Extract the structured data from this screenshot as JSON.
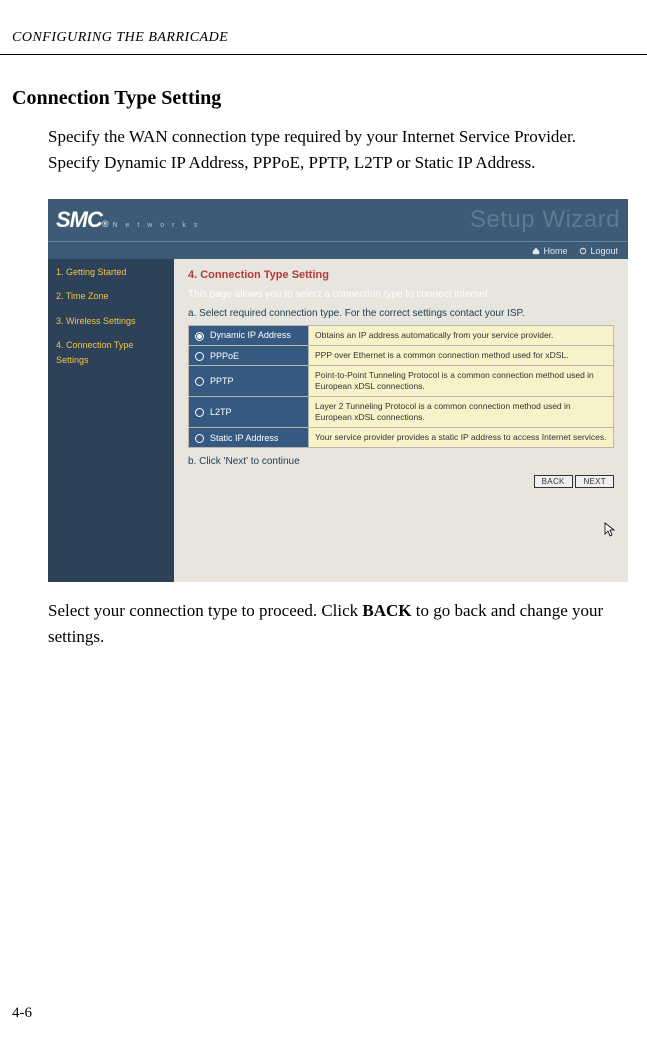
{
  "running_header": "CONFIGURING THE BARRICADE",
  "section_title": "Connection Type Setting",
  "intro": "Specify the WAN connection type required by your Internet Service Provider. Specify Dynamic IP Address, PPPoE, PPTP, L2TP or Static IP Address.",
  "outro_pre": "Select your connection type to proceed. Click ",
  "outro_bold": "BACK",
  "outro_post": " to go back and change your settings.",
  "page_number": "4-6",
  "shot": {
    "logo": "SMC",
    "logo_reg": "®",
    "logo_sub": "N e t w o r k s",
    "wizard": "Setup Wizard",
    "toolbar": {
      "home": "Home",
      "logout": "Logout"
    },
    "sidebar": {
      "items": [
        {
          "label": "1. Getting Started"
        },
        {
          "label": "2. Time Zone"
        },
        {
          "label": "3. Wireless Settings"
        },
        {
          "label": "4. Connection Type Settings"
        }
      ]
    },
    "panel": {
      "title": "4. Connection Type Setting",
      "line1": "This page allows you to select a connection type to connect internet.",
      "line2": "a. Select required connection type. For the correct settings contact your ISP.",
      "options": [
        {
          "name": "Dynamic IP Address",
          "desc": "Obtains an IP address automatically from your service provider.",
          "selected": true
        },
        {
          "name": "PPPoE",
          "desc": "PPP over Ethernet is a common connection method used for xDSL.",
          "selected": false
        },
        {
          "name": "PPTP",
          "desc": "Point-to-Point Tunneling Protocol is a common connection method used in European xDSL connections.",
          "selected": false
        },
        {
          "name": "L2TP",
          "desc": "Layer 2 Tunneling Protocol is a common connection method used in European xDSL connections.",
          "selected": false
        },
        {
          "name": "Static IP Address",
          "desc": "Your service provider provides a static IP address to access Internet services.",
          "selected": false
        }
      ],
      "line3": "b. Click 'Next' to continue",
      "back": "BACK",
      "next": "NEXT"
    }
  }
}
